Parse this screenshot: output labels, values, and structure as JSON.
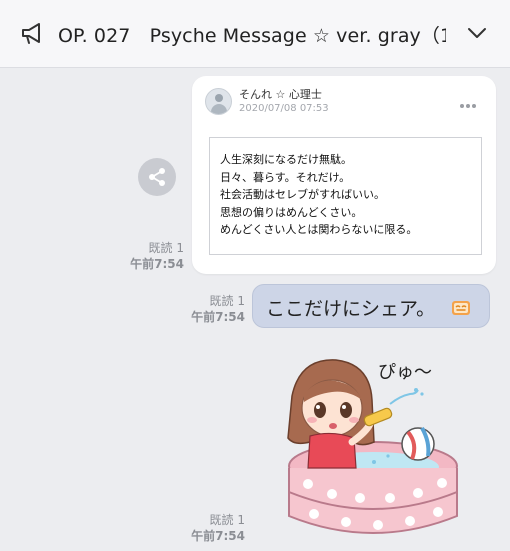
{
  "header": {
    "title": "OP. 027　Psyche Message ☆ ver. gray（1 ...",
    "icons": {
      "announce": "megaphone-icon",
      "expand": "chevron-down-icon"
    }
  },
  "share": {
    "icon": "share-icon"
  },
  "post": {
    "author": "そんれ ☆ 心理士",
    "date": "2020/07/08 07:53",
    "lines": [
      "人生深刻になるだけ無駄。",
      "日々、暮らす。それだけ。",
      "社会活動はセレブがすればいい。",
      "思想の偏りはめんどくさい。",
      "めんどくさい人とは関わらないに限る。"
    ]
  },
  "messages": [
    {
      "read": "既読 1",
      "time": "午前7:54"
    },
    {
      "read": "既読 1",
      "time": "午前7:54",
      "text": "ここだけにシェア。"
    },
    {
      "read": "既読 1",
      "time": "午前7:54",
      "sticker_text": "ぴゅ〜"
    }
  ],
  "colors": {
    "background": "#ecedf0",
    "bubble": "#cdd5e7",
    "header": "#f7f7f9"
  }
}
